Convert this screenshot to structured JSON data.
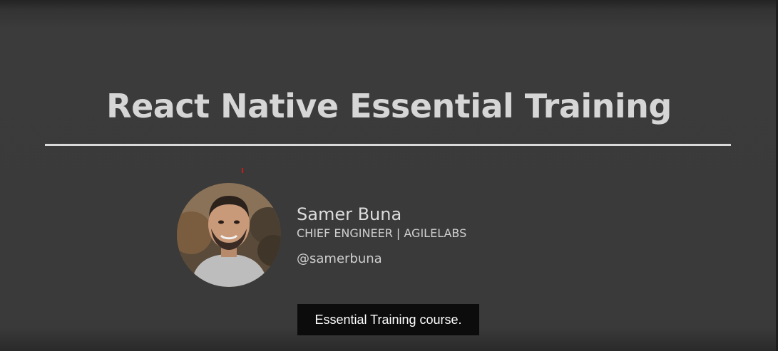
{
  "slide": {
    "title": "React Native Essential Training"
  },
  "presenter": {
    "name": "Samer Buna",
    "role": "CHIEF ENGINEER | AGILELABS",
    "handle": "@samerbuna"
  },
  "caption": {
    "text": "Essential Training course."
  },
  "colors": {
    "background": "#3a3a3a",
    "title_text": "#d6d6d6",
    "divider": "#dadada",
    "caption_background": "#0c0c0c",
    "caption_text": "#ffffff"
  }
}
